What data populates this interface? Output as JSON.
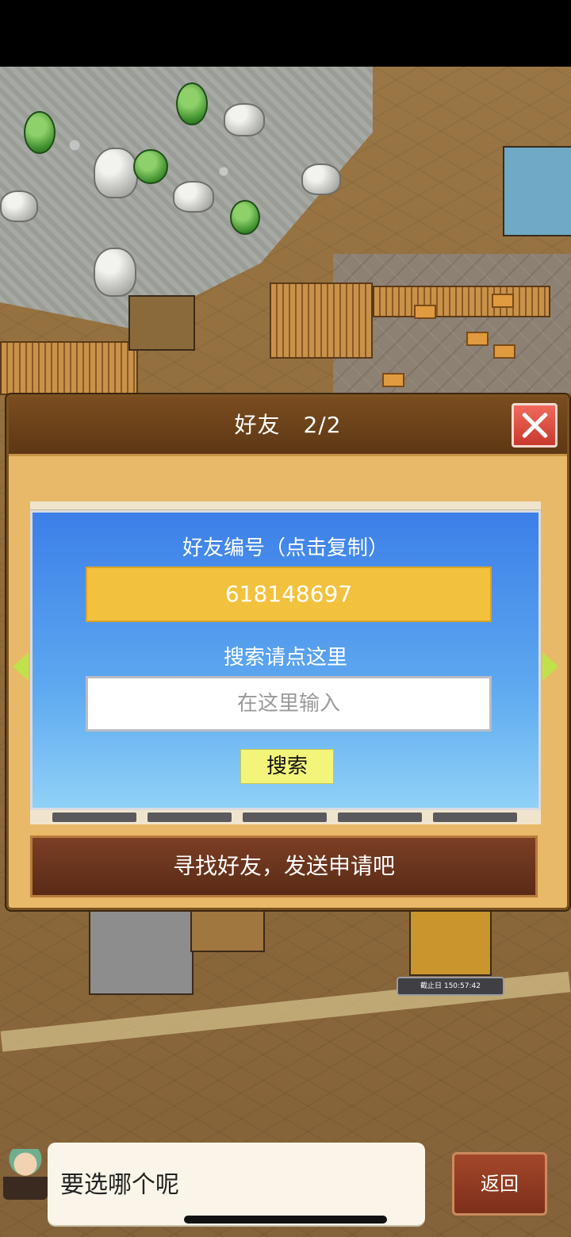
{
  "dialog": {
    "title": "好友　2/2",
    "friend_id_label": "好友编号（点击复制）",
    "friend_id": "618148697",
    "search_label": "搜索请点这里",
    "search_placeholder": "在这里输入",
    "search_button": "搜索",
    "find_friends_button": "寻找好友，发送申请吧"
  },
  "world": {
    "timer_text": "截止日 150:57:42"
  },
  "bottom": {
    "message": "要选哪个呢",
    "back_button": "返回"
  },
  "colors": {
    "dialog_header": "#5d3714",
    "panel_blue": "#3c7fe8",
    "id_box": "#f2c23f",
    "search_button": "#f2f57a",
    "close_button": "#c8392d"
  }
}
